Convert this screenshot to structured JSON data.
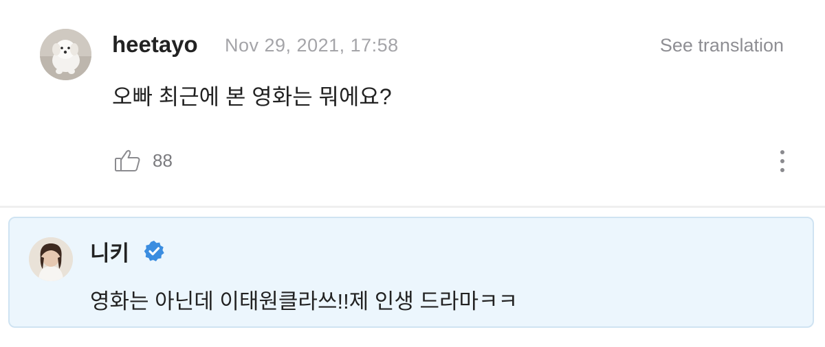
{
  "post": {
    "username": "heetayo",
    "timestamp": "Nov 29, 2021, 17:58",
    "translate_label": "See translation",
    "text": "오빠 최근에 본 영화는 뭐에요?",
    "like_count": "88",
    "icons": {
      "like": "thumbs-up-icon",
      "more": "more-vertical-icon"
    }
  },
  "reply": {
    "name": "니키",
    "verified_icon": "verified-badge-icon",
    "text": "영화는 아닌데 이태원클라쓰!!제 인생 드라마ㅋㅋ"
  },
  "colors": {
    "reply_background": "#ecf6fd",
    "reply_border": "#cfe3f2",
    "verified": "#3b8de0",
    "muted_text": "#a4a4a8"
  }
}
